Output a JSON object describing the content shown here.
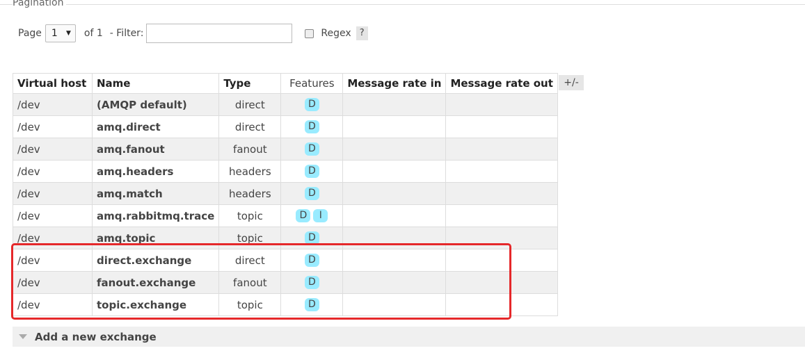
{
  "pagination": {
    "legend": "Pagination",
    "page_label": "Page",
    "page_value": "1",
    "of_label": "of 1",
    "filter_label": "- Filter:",
    "filter_value": "",
    "regex_label": "Regex",
    "help_label": "?"
  },
  "table": {
    "headers": {
      "vhost": "Virtual host",
      "name": "Name",
      "type": "Type",
      "features": "Features",
      "rate_in": "Message rate in",
      "rate_out": "Message rate out"
    },
    "column_toggle": "+/-",
    "rows": [
      {
        "vhost": "/dev",
        "name": "(AMQP default)",
        "type": "direct",
        "features": [
          "D"
        ],
        "rate_in": "",
        "rate_out": ""
      },
      {
        "vhost": "/dev",
        "name": "amq.direct",
        "type": "direct",
        "features": [
          "D"
        ],
        "rate_in": "",
        "rate_out": ""
      },
      {
        "vhost": "/dev",
        "name": "amq.fanout",
        "type": "fanout",
        "features": [
          "D"
        ],
        "rate_in": "",
        "rate_out": ""
      },
      {
        "vhost": "/dev",
        "name": "amq.headers",
        "type": "headers",
        "features": [
          "D"
        ],
        "rate_in": "",
        "rate_out": ""
      },
      {
        "vhost": "/dev",
        "name": "amq.match",
        "type": "headers",
        "features": [
          "D"
        ],
        "rate_in": "",
        "rate_out": ""
      },
      {
        "vhost": "/dev",
        "name": "amq.rabbitmq.trace",
        "type": "topic",
        "features": [
          "D",
          "I"
        ],
        "rate_in": "",
        "rate_out": ""
      },
      {
        "vhost": "/dev",
        "name": "amq.topic",
        "type": "topic",
        "features": [
          "D"
        ],
        "rate_in": "",
        "rate_out": ""
      },
      {
        "vhost": "/dev",
        "name": "direct.exchange",
        "type": "direct",
        "features": [
          "D"
        ],
        "rate_in": "",
        "rate_out": ""
      },
      {
        "vhost": "/dev",
        "name": "fanout.exchange",
        "type": "fanout",
        "features": [
          "D"
        ],
        "rate_in": "",
        "rate_out": ""
      },
      {
        "vhost": "/dev",
        "name": "topic.exchange",
        "type": "topic",
        "features": [
          "D"
        ],
        "rate_in": "",
        "rate_out": ""
      }
    ]
  },
  "add_section": {
    "icon": "triangle-down-icon",
    "label": "Add a new exchange"
  },
  "colors": {
    "feature_badge": "#99ebff",
    "highlight_border": "#e5282a",
    "alt_row": "#f0f0f0"
  }
}
